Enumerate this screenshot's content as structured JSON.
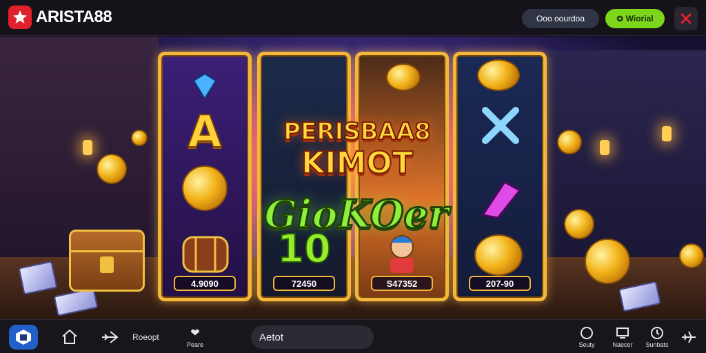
{
  "header": {
    "brand": "ARISTA88",
    "pill_label": "Ooo oourdoa",
    "cta_label": "Wiorial"
  },
  "scene": {
    "headline_1": "PERISBAA8",
    "headline_2": "KIMOT",
    "subhead": "GioKOer",
    "reels": [
      {
        "symbol": "A",
        "value": "4.9090"
      },
      {
        "symbol": "10",
        "value": "72450"
      },
      {
        "symbol": "",
        "value": "S47352"
      },
      {
        "symbol": "",
        "value": "207-90"
      }
    ]
  },
  "bottom_bar": {
    "label_repart": "Roeopt",
    "label_heart": "Peare",
    "search_value": "Aetot",
    "tools": [
      {
        "label": "Seuty"
      },
      {
        "label": "Naecer"
      },
      {
        "label": "Sunbats"
      }
    ]
  },
  "colors": {
    "brand_red": "#e0202a",
    "cta_green": "#7dd61a",
    "reel_gold": "#f3b73c",
    "home_badge_blue": "#2160c8"
  },
  "icons": [
    "logo-star-icon",
    "brand-icon",
    "close-icon",
    "home-badge-icon",
    "house-icon",
    "airplane-icon",
    "heart-icon",
    "chat-icon",
    "monitor-icon",
    "clock-icon",
    "fighter-jet-icon"
  ]
}
